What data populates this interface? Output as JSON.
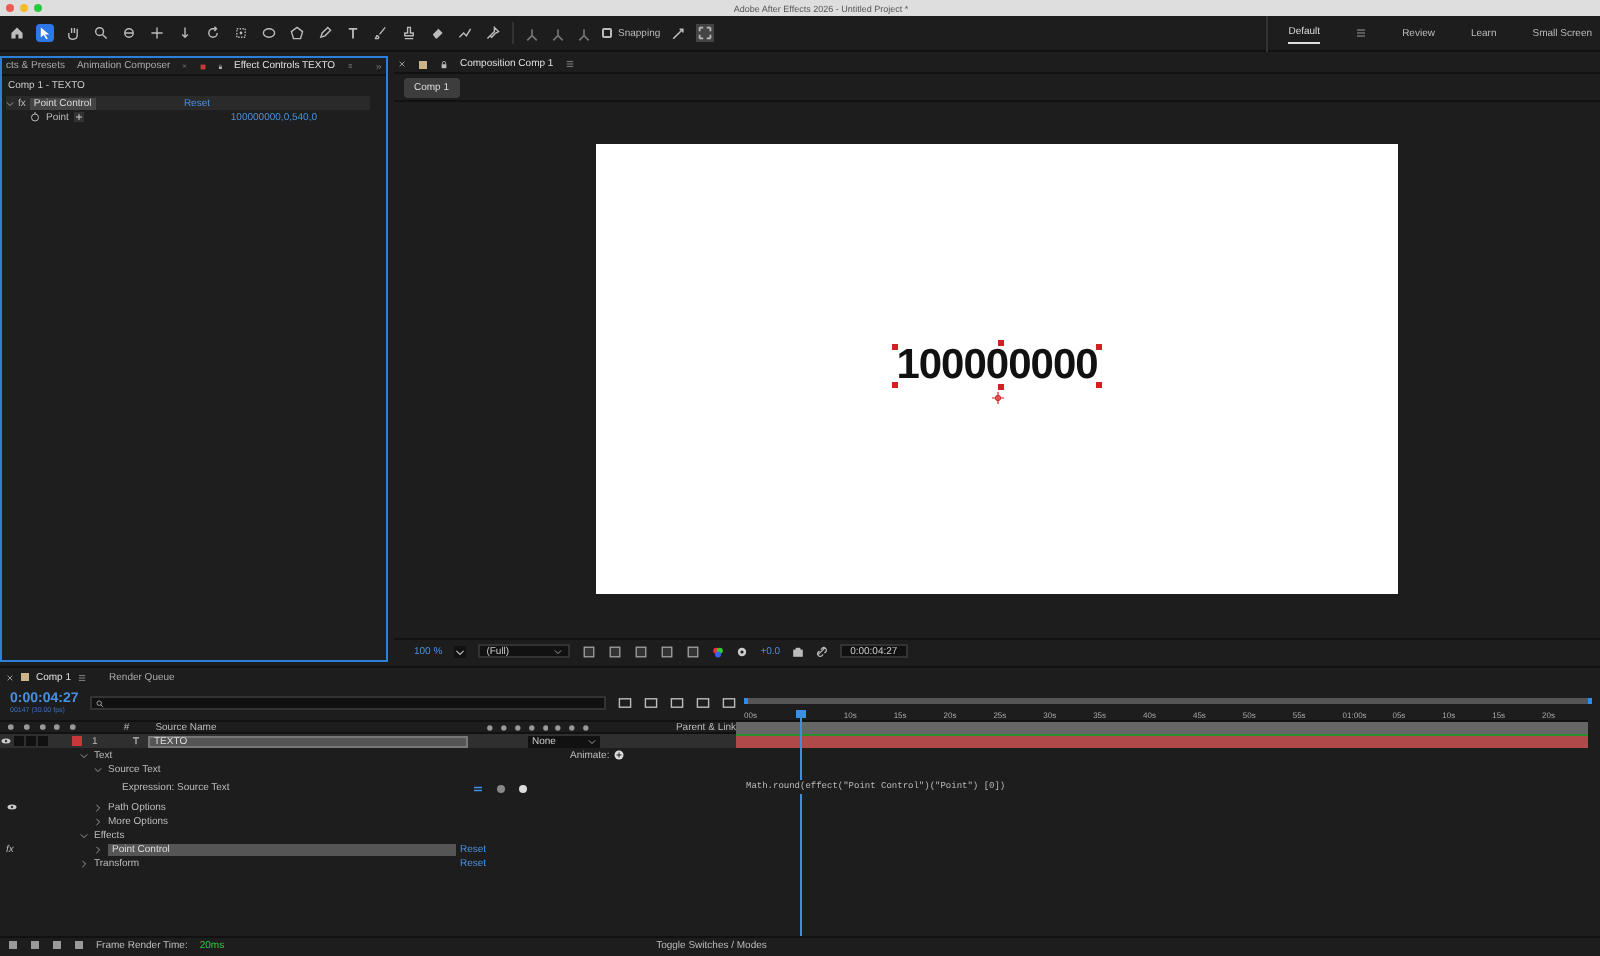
{
  "window": {
    "title": "Adobe After Effects 2026 - Untitled Project *"
  },
  "toolbar": {
    "snapping": {
      "label": "Snapping",
      "checked": false
    },
    "workspaces": [
      {
        "label": "Default",
        "selected": true
      },
      {
        "label": "Review",
        "selected": false
      },
      {
        "label": "Learn",
        "selected": false
      },
      {
        "label": "Small Screen",
        "selected": false
      }
    ]
  },
  "left_panel": {
    "tabs": [
      {
        "label": "cts & Presets",
        "selected": false
      },
      {
        "label": "Animation Composer",
        "selected": false
      },
      {
        "label": "Effect Controls TEXTO",
        "selected": true
      }
    ],
    "breadcrumb": "Comp 1 - TEXTO",
    "effects": [
      {
        "badge": "fx",
        "name": "Point Control",
        "reset": "Reset",
        "expanded": true,
        "properties": [
          {
            "name": "Point",
            "value": "100000000,0,540,0"
          }
        ]
      }
    ]
  },
  "composition_panel": {
    "tabs": [
      {
        "label": "Composition Comp 1",
        "selected": true
      }
    ],
    "breadcrumbs": [
      {
        "label": "Comp 1",
        "selected": true
      }
    ],
    "canvas": {
      "text": "100000000"
    },
    "viewer_bar": {
      "zoom": "100 %",
      "resolution": "(Full)",
      "exposure": "+0.0",
      "timecode": "0:00:04:27"
    }
  },
  "timeline": {
    "tabs": [
      {
        "label": "Comp 1",
        "selected": true
      },
      {
        "label": "Render Queue",
        "selected": false
      }
    ],
    "current_time": "0:00:04:27",
    "frame_info": "00147 (30.00 fps)",
    "columns": [
      "#",
      "Source Name",
      "Parent & Link"
    ],
    "ruler": [
      "00s",
      "10s",
      "15s",
      "20s",
      "25s",
      "30s",
      "35s",
      "40s",
      "45s",
      "50s",
      "55s",
      "01:00s",
      "05s",
      "10s",
      "15s",
      "20s"
    ],
    "playhead": {
      "level": 0.064
    },
    "layers": [
      {
        "number": "1",
        "name": "TEXTO",
        "selected": true,
        "visible": true,
        "parent": "None",
        "children": [
          {
            "name": "Text",
            "expanded": true,
            "animate": "Animate:",
            "children": [
              {
                "name": "Source Text",
                "expanded": true,
                "children": [
                  {
                    "name": "Expression: Source Text",
                    "expression": "Math.round(effect(\"Point Control\")(\"Point\") [0])"
                  }
                ]
              },
              {
                "name": "Path Options",
                "expanded": false,
                "visible": true
              },
              {
                "name": "More Options",
                "expanded": false
              }
            ]
          },
          {
            "name": "Effects",
            "expanded": true,
            "children": [
              {
                "name": "Point Control",
                "expanded": false,
                "badge": "fx",
                "reset": "Reset",
                "selected": true
              }
            ]
          },
          {
            "name": "Transform",
            "expanded": false,
            "reset": "Reset"
          }
        ]
      }
    ]
  },
  "status_bar": {
    "render_time_label": "Frame Render Time:",
    "render_time": "20ms",
    "toggle": "Toggle Switches / Modes"
  }
}
